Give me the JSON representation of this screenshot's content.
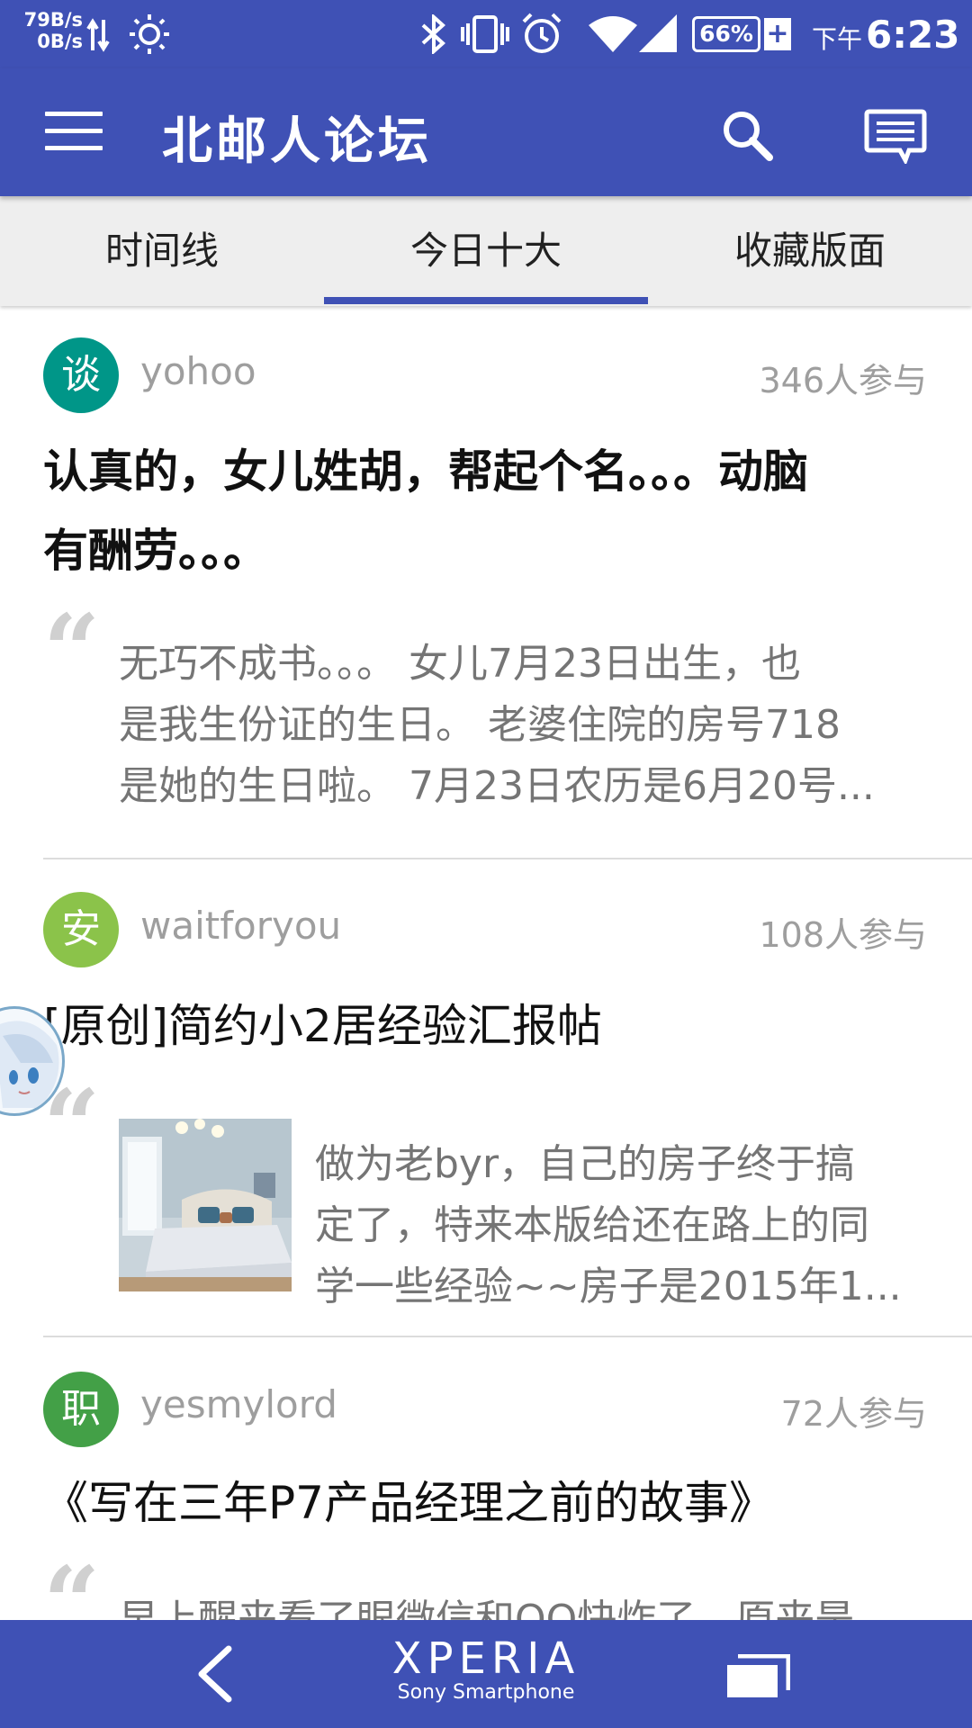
{
  "status_bar": {
    "net_up": "79B/s",
    "net_down": "0B/s",
    "battery": "66%",
    "battery_plus": "+",
    "time_prefix": "下午",
    "time": "6:23"
  },
  "app_bar": {
    "title": "北邮人论坛"
  },
  "tabs": [
    {
      "label": "时间线",
      "active": false
    },
    {
      "label": "今日十大",
      "active": true
    },
    {
      "label": "收藏版面",
      "active": false
    }
  ],
  "posts": [
    {
      "avatar_text": "谈",
      "avatar_color": "#009688",
      "author": "yohoo",
      "participants": "346人参与",
      "title_line1": "认真的，女儿姓胡，帮起个名。。。动脑",
      "title_line2": "有酬劳。。。",
      "quote": "“",
      "excerpt_lines": [
        "无巧不成书。。。 女儿7月23日出生，也",
        "是我生份证的生日。 老婆住院的房号718",
        "是她的生日啦。 7月23日农历是6月20号..."
      ]
    },
    {
      "avatar_text": "安",
      "avatar_color": "#8bc34a",
      "author": "waitforyou",
      "participants": "108人参与",
      "title_line1": "[原创]简约小2居经验汇报帖",
      "quote": "“",
      "excerpt_lines": [
        "做为老byr，自己的房子终于搞",
        "定了，特来本版给还在路上的同",
        "学一些经验~~房子是2015年1..."
      ]
    },
    {
      "avatar_text": "职",
      "avatar_color": "#43a047",
      "author": "yesmylord",
      "participants": "72人参与",
      "title_line1": "《写在三年P7产品经理之前的故事》",
      "quote": "“",
      "excerpt_lines": [
        "早上醒来看了眼微信和QQ快炸了，原来是"
      ]
    }
  ],
  "nav_bar": {
    "brand": "XPERIA",
    "sub": "Sony Smartphone"
  },
  "colors": {
    "primary": "#3f51b5",
    "tab_background": "#eeeeee"
  }
}
